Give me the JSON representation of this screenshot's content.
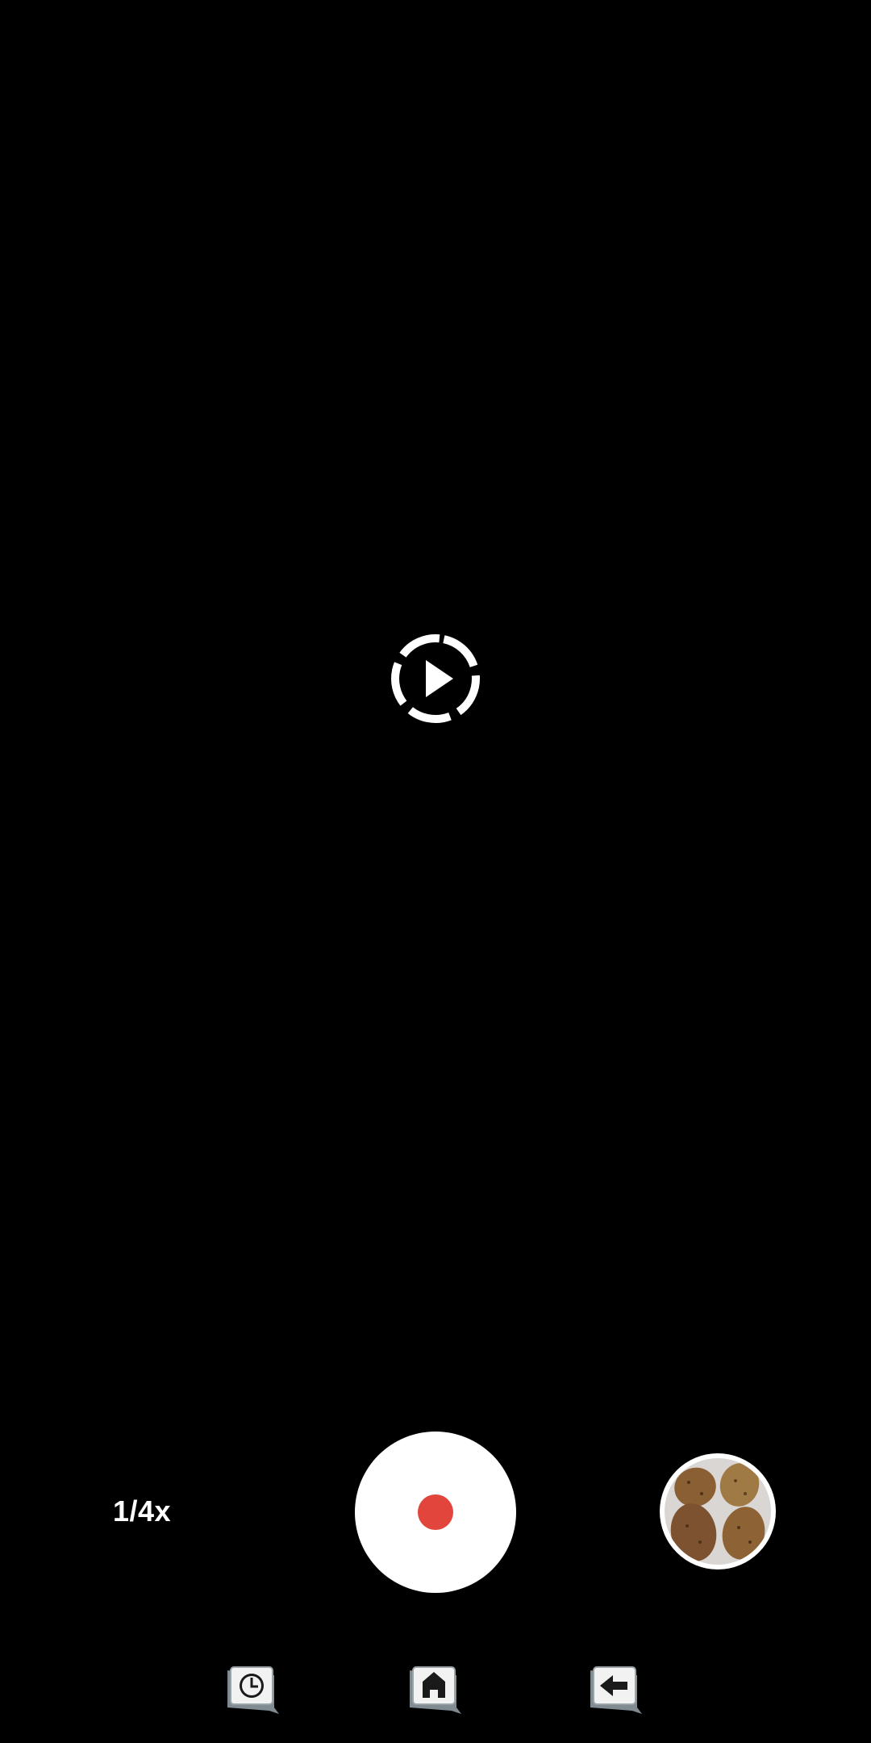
{
  "camera": {
    "mode_icon": "slow-motion-play-icon",
    "speed_label": "1/4x",
    "record_icon": "record-dot-icon",
    "record_color": "#e2453b",
    "thumbnail_icon": "last-capture-thumbnail"
  },
  "nav": {
    "items": [
      {
        "icon": "recent-apps-icon"
      },
      {
        "icon": "home-icon"
      },
      {
        "icon": "back-icon"
      }
    ]
  }
}
